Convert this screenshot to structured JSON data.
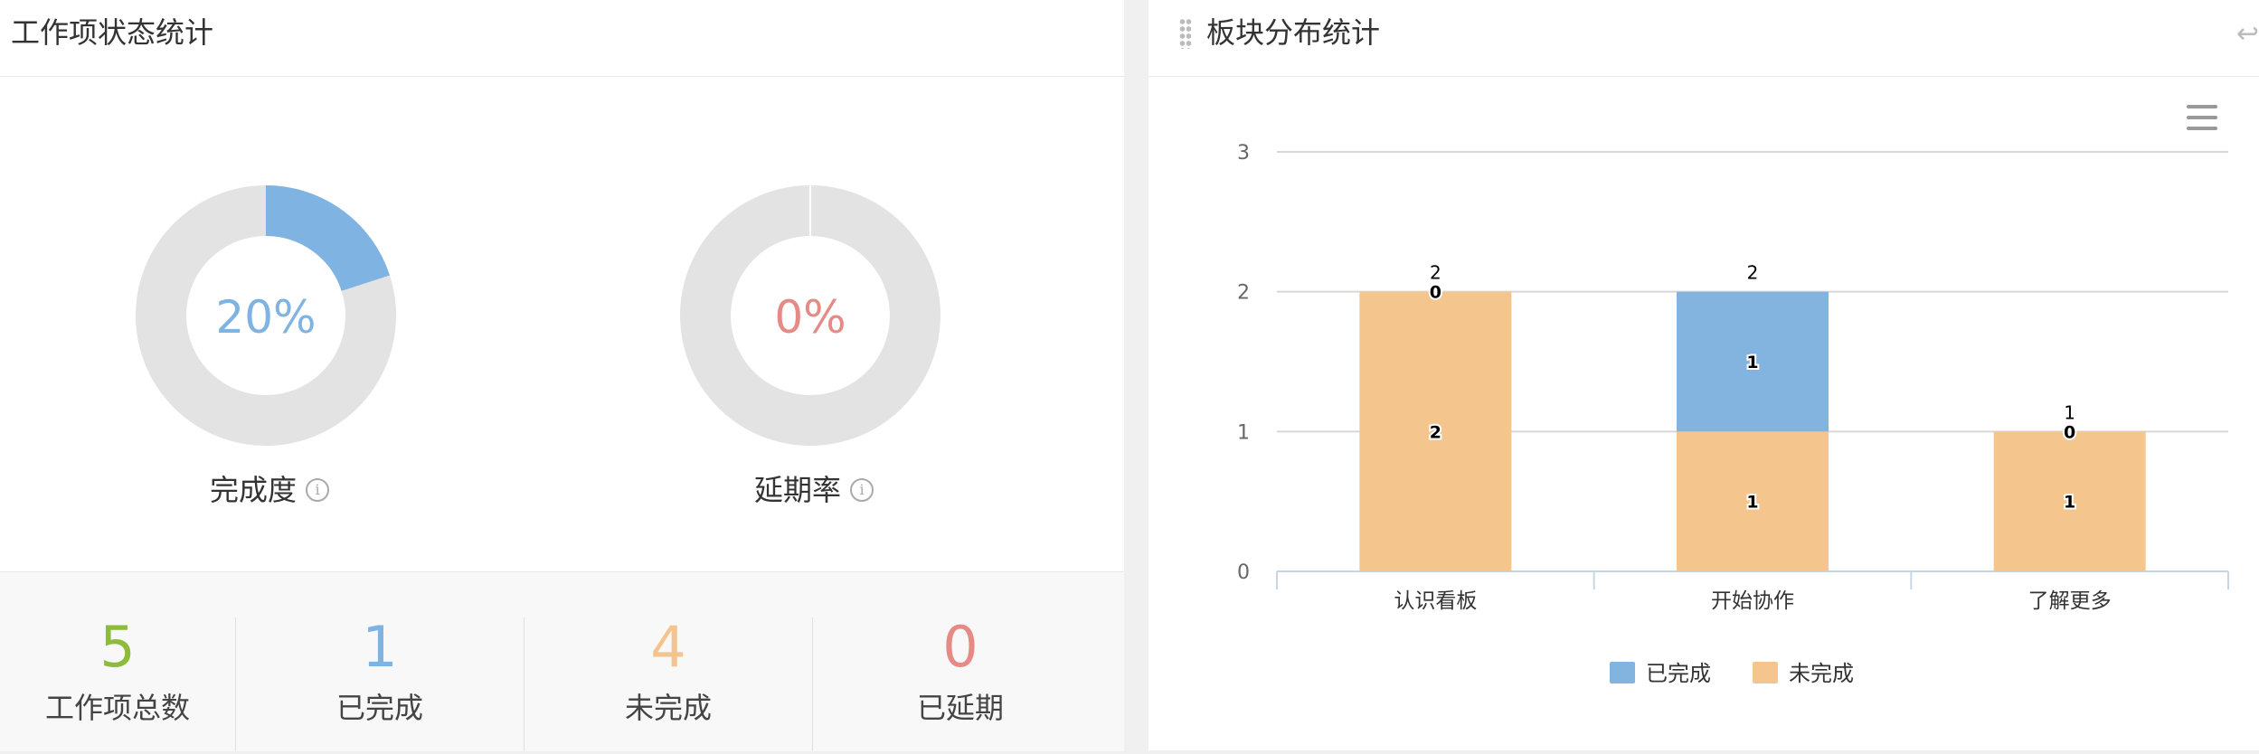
{
  "left_panel": {
    "title": "工作项状态统计",
    "donuts": {
      "completion": {
        "value_text": "20%",
        "label": "完成度",
        "fraction": 0.2,
        "color": "#7fb3e2"
      },
      "delay": {
        "value_text": "0%",
        "label": "延期率",
        "fraction": 0.0,
        "color": "#e58a85"
      }
    },
    "info_icon_glyph": "i",
    "stats": [
      {
        "value": "5",
        "label": "工作项总数",
        "color": "#8dbb3c"
      },
      {
        "value": "1",
        "label": "已完成",
        "color": "#7fb3e2"
      },
      {
        "value": "4",
        "label": "未完成",
        "color": "#f3c48e"
      },
      {
        "value": "0",
        "label": "已延期",
        "color": "#e58a85"
      }
    ]
  },
  "right_panel": {
    "title": "板块分布统计",
    "collapse_icon_glyph": "↩"
  },
  "colors": {
    "done": "#83b4e0",
    "undone": "#f4c68e",
    "ring_track": "#e3e3e3"
  },
  "chart_data": {
    "type": "bar",
    "stacked": true,
    "categories": [
      "认识看板",
      "开始协作",
      "了解更多"
    ],
    "series": [
      {
        "name": "已完成",
        "values": [
          0,
          1,
          0
        ],
        "color": "#83b4e0"
      },
      {
        "name": "未完成",
        "values": [
          2,
          1,
          1
        ],
        "color": "#f4c68e"
      }
    ],
    "totals": [
      2,
      2,
      1
    ],
    "ylim": [
      0,
      3
    ],
    "yticks": [
      0,
      1,
      2,
      3
    ],
    "grid": true,
    "legend_position": "bottom-center"
  }
}
